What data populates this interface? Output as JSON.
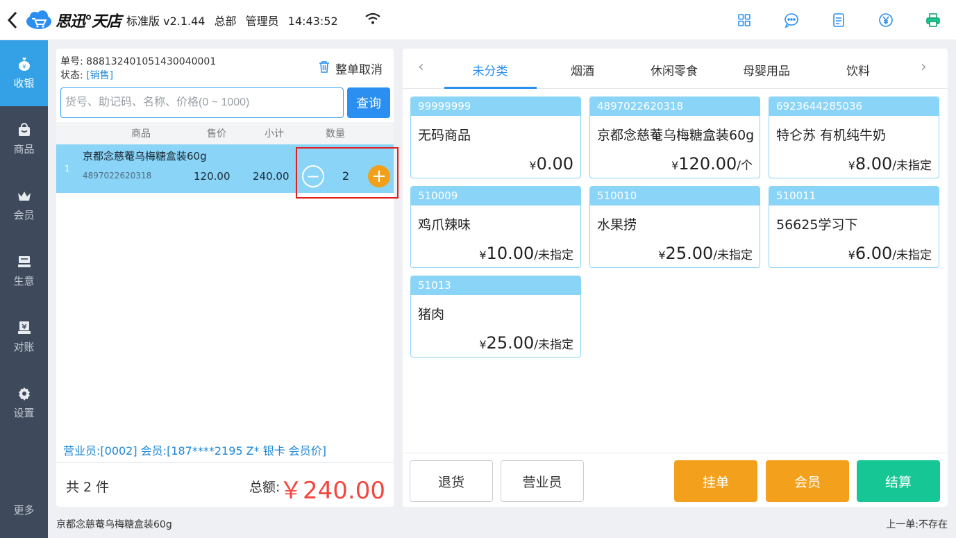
{
  "header": {
    "brand": "思迅°天店",
    "edition": "标准版 v2.1.44",
    "store": "总部",
    "role": "管理员",
    "time": "14:43:52",
    "icons": [
      "grid-icon",
      "chat-icon",
      "document-icon",
      "yen-icon",
      "printer-icon"
    ]
  },
  "sidebar": {
    "items": [
      {
        "label": "收银",
        "icon": "money-bag-icon",
        "active": true
      },
      {
        "label": "商品",
        "icon": "shopping-bag-icon",
        "active": false
      },
      {
        "label": "会员",
        "icon": "crown-icon",
        "active": false
      },
      {
        "label": "生意",
        "icon": "register-icon",
        "active": false
      },
      {
        "label": "对账",
        "icon": "reconcile-icon",
        "active": false
      },
      {
        "label": "设置",
        "icon": "gear-icon",
        "active": false
      }
    ],
    "more": "更多"
  },
  "order": {
    "number_label": "单号:",
    "number": "888132401051430040001",
    "status_label": "状态:",
    "status": "[销售]",
    "cancel_all": "整单取消",
    "search_placeholder": "货号、助记码、名称、价格(0 ~ 1000)",
    "search_button": "查询",
    "columns": {
      "product": "商品",
      "price": "售价",
      "subtotal": "小计",
      "qty": "数量"
    },
    "items": [
      {
        "index": "1",
        "name": "京都念慈菴乌梅糖盒装60g",
        "code": "4897022620318",
        "price": "120.00",
        "subtotal": "240.00",
        "qty": "2"
      }
    ],
    "staff_member": "营业员:[0002]   会员:[187****2195 Z* 银卡 会员价]",
    "count": "共 2 件",
    "total_label": "总额:",
    "total": "￥240.00"
  },
  "categories": {
    "tabs": [
      "未分类",
      "烟酒",
      "休闲零食",
      "母婴用品",
      "饮料"
    ],
    "active": "未分类"
  },
  "products": [
    {
      "code": "99999999",
      "name": "无码商品",
      "yen": "¥",
      "price": "0.00",
      "unit": ""
    },
    {
      "code": "4897022620318",
      "name": "京都念慈菴乌梅糖盒装60g",
      "yen": "¥",
      "price": "120.00",
      "unit": "/个"
    },
    {
      "code": "6923644285036",
      "name": "特仑苏 有机纯牛奶",
      "yen": "¥",
      "price": "8.00",
      "unit": "/未指定"
    },
    {
      "code": "510009",
      "name": "鸡爪辣味",
      "yen": "¥",
      "price": "10.00",
      "unit": "/未指定"
    },
    {
      "code": "510010",
      "name": "水果捞",
      "yen": "¥",
      "price": "25.00",
      "unit": "/未指定"
    },
    {
      "code": "510011",
      "name": "56625学习下",
      "yen": "¥",
      "price": "6.00",
      "unit": "/未指定"
    },
    {
      "code": "51013",
      "name": "猪肉",
      "yen": "¥",
      "price": "25.00",
      "unit": "/未指定"
    }
  ],
  "actions": {
    "return": "退货",
    "staff": "营业员",
    "hold": "挂单",
    "member": "会员",
    "checkout": "结算"
  },
  "statusbar": {
    "left": "京都念慈菴乌梅糖盒装60g",
    "right": "上一单:不存在"
  },
  "colors": {
    "accent": "#2a8ff0",
    "row_highlight": "#8ad4f7",
    "orange": "#f3a11c",
    "green": "#16c795",
    "total_red": "#f2473f",
    "sidebar": "#3e4a5b"
  }
}
